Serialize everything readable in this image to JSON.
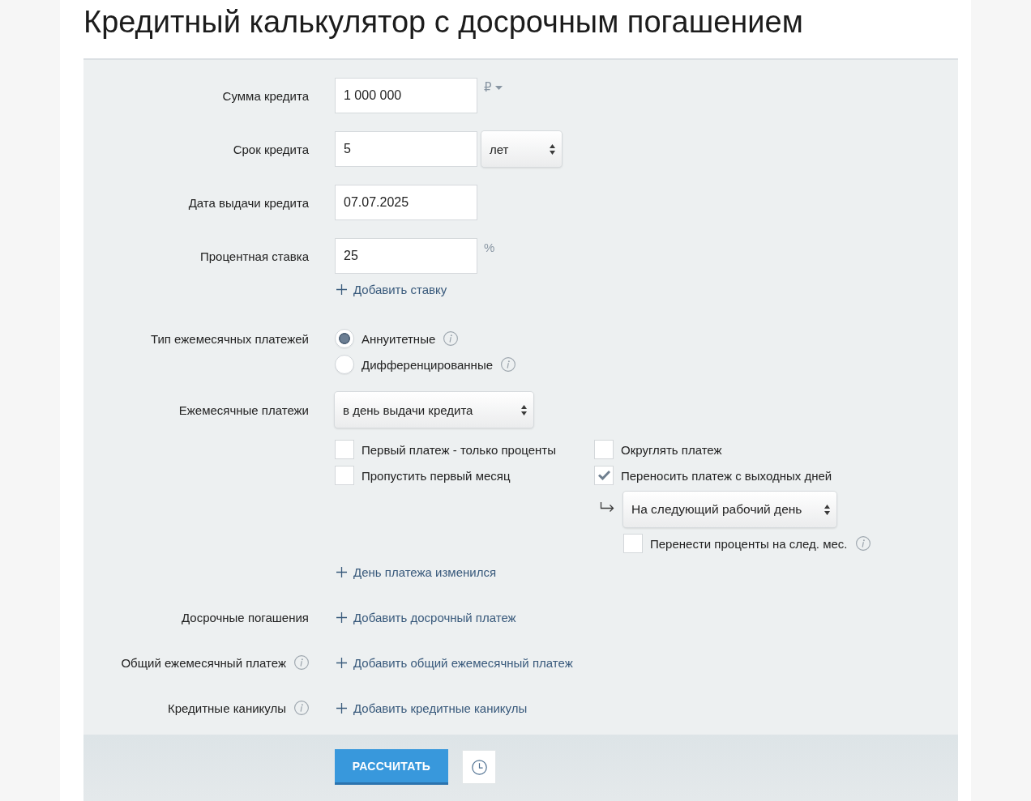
{
  "title": "Кредитный калькулятор с досрочным погашением",
  "form": {
    "rows": [
      {
        "kind": "input",
        "label": "Сумма кредита",
        "value": "1 000 000",
        "unit": {
          "text": "₽",
          "menu": true
        }
      },
      {
        "kind": "input",
        "label": "Срок кредита",
        "value": "5",
        "select": "лет"
      },
      {
        "kind": "input",
        "label": "Дата выдачи кредита",
        "value": "07.07.2025"
      },
      {
        "kind": "input",
        "label": "Процентная ставка",
        "value": "25",
        "unit": {
          "text": "%",
          "menu": false
        },
        "links": [
          "Добавить ставку"
        ]
      },
      {
        "kind": "radio",
        "label": "Тип ежемесячных платежей",
        "options": [
          {
            "label": "Аннуитетные",
            "selected": true,
            "info": true
          },
          {
            "label": "Дифференцированные",
            "selected": false,
            "info": true
          }
        ]
      },
      {
        "kind": "select",
        "label": "Ежемесячные платежи",
        "value": "в день выдачи кредита",
        "checkbox_columns": [
          [
            {
              "label": "Первый платеж - только проценты",
              "checked": false
            },
            {
              "label": "Пропустить первый месяц",
              "checked": false
            }
          ],
          [
            {
              "label": "Округлять платеж",
              "checked": false
            },
            {
              "label": "Переносить платеж с выходных дней",
              "checked": true,
              "sub": {
                "select": "На следующий рабочий день",
                "option": {
                  "label": "Перенести проценты на след. мес.",
                  "checked": false,
                  "info": true
                }
              }
            }
          ]
        ],
        "links": [
          "День платежа изменился"
        ]
      },
      {
        "kind": "link",
        "label": "Досрочные погашения",
        "info": false,
        "links": [
          "Добавить досрочный платеж"
        ]
      },
      {
        "kind": "link",
        "label": "Общий ежемесячный платеж",
        "info": true,
        "links": [
          "Добавить общий ежемесячный платеж"
        ]
      },
      {
        "kind": "link",
        "label": "Кредитные каникулы",
        "info": true,
        "links": [
          "Добавить кредитные каникулы"
        ]
      }
    ]
  },
  "footer": {
    "button": "РАССЧИТАТЬ"
  }
}
